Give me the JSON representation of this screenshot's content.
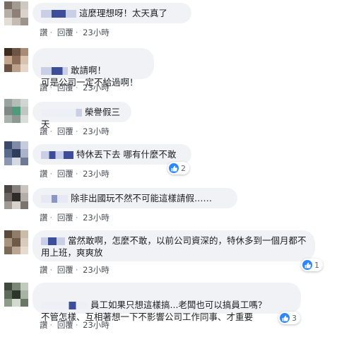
{
  "colors": {
    "bubble": "#f0f2f5",
    "like_blue": "#2d88ff",
    "meta_text": "#4b4f56"
  },
  "comments": [
    {
      "text": "這麼理想呀！太天真了",
      "actions": {
        "like": "讚",
        "reply": "回覆",
        "time": "23小時"
      }
    },
    {
      "text": "敢請啊！\n可是公司一定不給過啊！",
      "actions": {
        "like": "讚",
        "reply": "回覆",
        "time": "23小時"
      }
    },
    {
      "text": "榮譽假三天",
      "actions": {
        "like": "讚",
        "reply": "回覆",
        "time": "23小時"
      }
    },
    {
      "text": "特休丟下去 哪有什麼不敢",
      "actions": {
        "like": "讚",
        "reply": "回覆",
        "time": "23小時"
      },
      "reaction": {
        "icon": "thumbs-up-icon",
        "count": "2"
      }
    },
    {
      "text": "除非出國玩不然不可能這樣請假……",
      "actions": {
        "like": "讚",
        "reply": "回覆",
        "time": "23小時"
      }
    },
    {
      "text": "當然敢啊，怎麼不敢，以前公司資深的，特休多到一個月都不用上班，爽爽放",
      "actions": {
        "like": "讚",
        "reply": "回覆",
        "time": "23小時"
      },
      "reaction": {
        "icon": "thumbs-up-icon",
        "count": "1"
      }
    },
    {
      "text": "員工如果只想這樣搞...老闆也可以搞員工嗎？\n不管怎樣、互相著想一下不影響公司工作同事、才重要",
      "actions": {
        "like": "讚",
        "reply": "回覆",
        "time": "23小時"
      },
      "reaction": {
        "icon": "thumbs-up-icon",
        "count": "3"
      }
    }
  ]
}
